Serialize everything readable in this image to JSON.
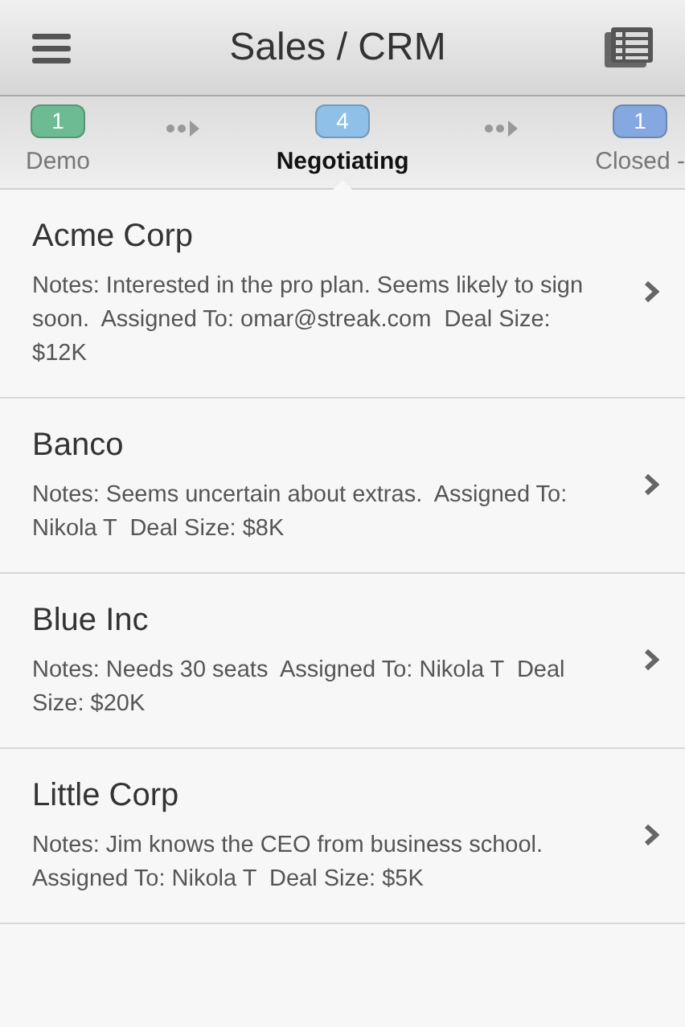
{
  "header": {
    "title": "Sales / CRM"
  },
  "stages": [
    {
      "label": "Demo",
      "count": "1",
      "color": "#6dbb93",
      "selected": false
    },
    {
      "label": "Negotiating",
      "count": "4",
      "color": "#8ec0e8",
      "selected": true
    },
    {
      "label": "Closed -",
      "count": "1",
      "color": "#86a8e0",
      "selected": false
    }
  ],
  "deals": [
    {
      "name": "Acme Corp",
      "notes": "Notes: Interested in the pro plan. Seems likely to sign soon.  Assigned To: omar@streak.com  Deal Size: $12K"
    },
    {
      "name": "Banco",
      "notes": "Notes: Seems uncertain about extras.  Assigned To: Nikola T  Deal Size: $8K"
    },
    {
      "name": "Blue Inc",
      "notes": "Notes: Needs 30 seats  Assigned To: Nikola T  Deal Size: $20K"
    },
    {
      "name": "Little Corp",
      "notes": "Notes: Jim knows the CEO from business school.  Assigned To: Nikola T  Deal Size: $5K"
    }
  ]
}
